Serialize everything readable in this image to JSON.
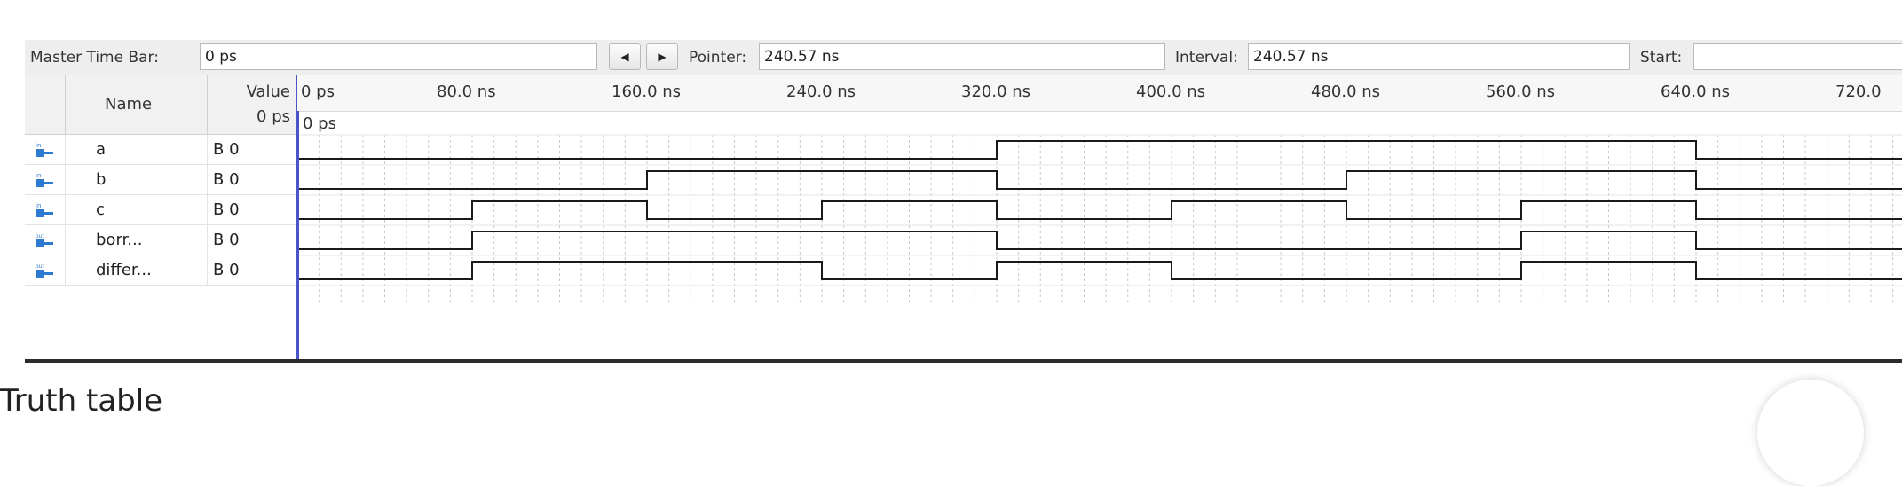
{
  "toolbar": {
    "master_time_bar_label": "Master Time Bar:",
    "master_time_bar_value": "0 ps",
    "prev_icon": "left-arrow",
    "next_icon": "right-arrow",
    "pointer_label": "Pointer:",
    "pointer_value": "240.57 ns",
    "interval_label": "Interval:",
    "interval_value": "240.57 ns",
    "start_label": "Start:",
    "start_value": ""
  },
  "columns": {
    "name": "Name",
    "value": "Value",
    "value_sub": "0 ps"
  },
  "timeline": {
    "ticks": [
      "0 ps",
      "80.0 ns",
      "160.0 ns",
      "240.0 ns",
      "320.0 ns",
      "400.0 ns",
      "480.0 ns",
      "560.0 ns",
      "640.0 ns",
      "720.0"
    ],
    "cursor_label": "0 ps",
    "time_unit": "ns",
    "period": 80
  },
  "signals": [
    {
      "name": "a",
      "value": "B 0",
      "direction": "in",
      "icon": "input-pin-icon",
      "levels": [
        0,
        0,
        0,
        0,
        0,
        0,
        0,
        0,
        1,
        1,
        1,
        1,
        1,
        1,
        1,
        1,
        0,
        0
      ]
    },
    {
      "name": "b",
      "value": "B 0",
      "direction": "in",
      "icon": "input-pin-icon",
      "levels": [
        0,
        0,
        0,
        0,
        1,
        1,
        1,
        1,
        0,
        0,
        0,
        0,
        1,
        1,
        1,
        1,
        0,
        0
      ]
    },
    {
      "name": "c",
      "value": "B 0",
      "direction": "in",
      "icon": "input-pin-icon",
      "levels": [
        0,
        0,
        1,
        1,
        0,
        0,
        1,
        1,
        0,
        0,
        1,
        1,
        0,
        0,
        1,
        1,
        0,
        0
      ]
    },
    {
      "name": "borr...",
      "value": "B 0",
      "direction": "out",
      "icon": "output-pin-icon",
      "levels": [
        0,
        0,
        1,
        1,
        1,
        1,
        1,
        1,
        0,
        0,
        0,
        0,
        0,
        0,
        1,
        1,
        0,
        0
      ]
    },
    {
      "name": "differ...",
      "value": "B 0",
      "direction": "out",
      "icon": "output-pin-icon",
      "levels": [
        0,
        0,
        1,
        1,
        1,
        1,
        0,
        0,
        1,
        1,
        0,
        0,
        0,
        0,
        1,
        1,
        0,
        0
      ]
    }
  ],
  "page_below": {
    "heading_partial": "Truth table"
  },
  "colors": {
    "wave": "#1a1a1a",
    "divider": "#4a55c8",
    "grid": "#c9c9c9"
  }
}
